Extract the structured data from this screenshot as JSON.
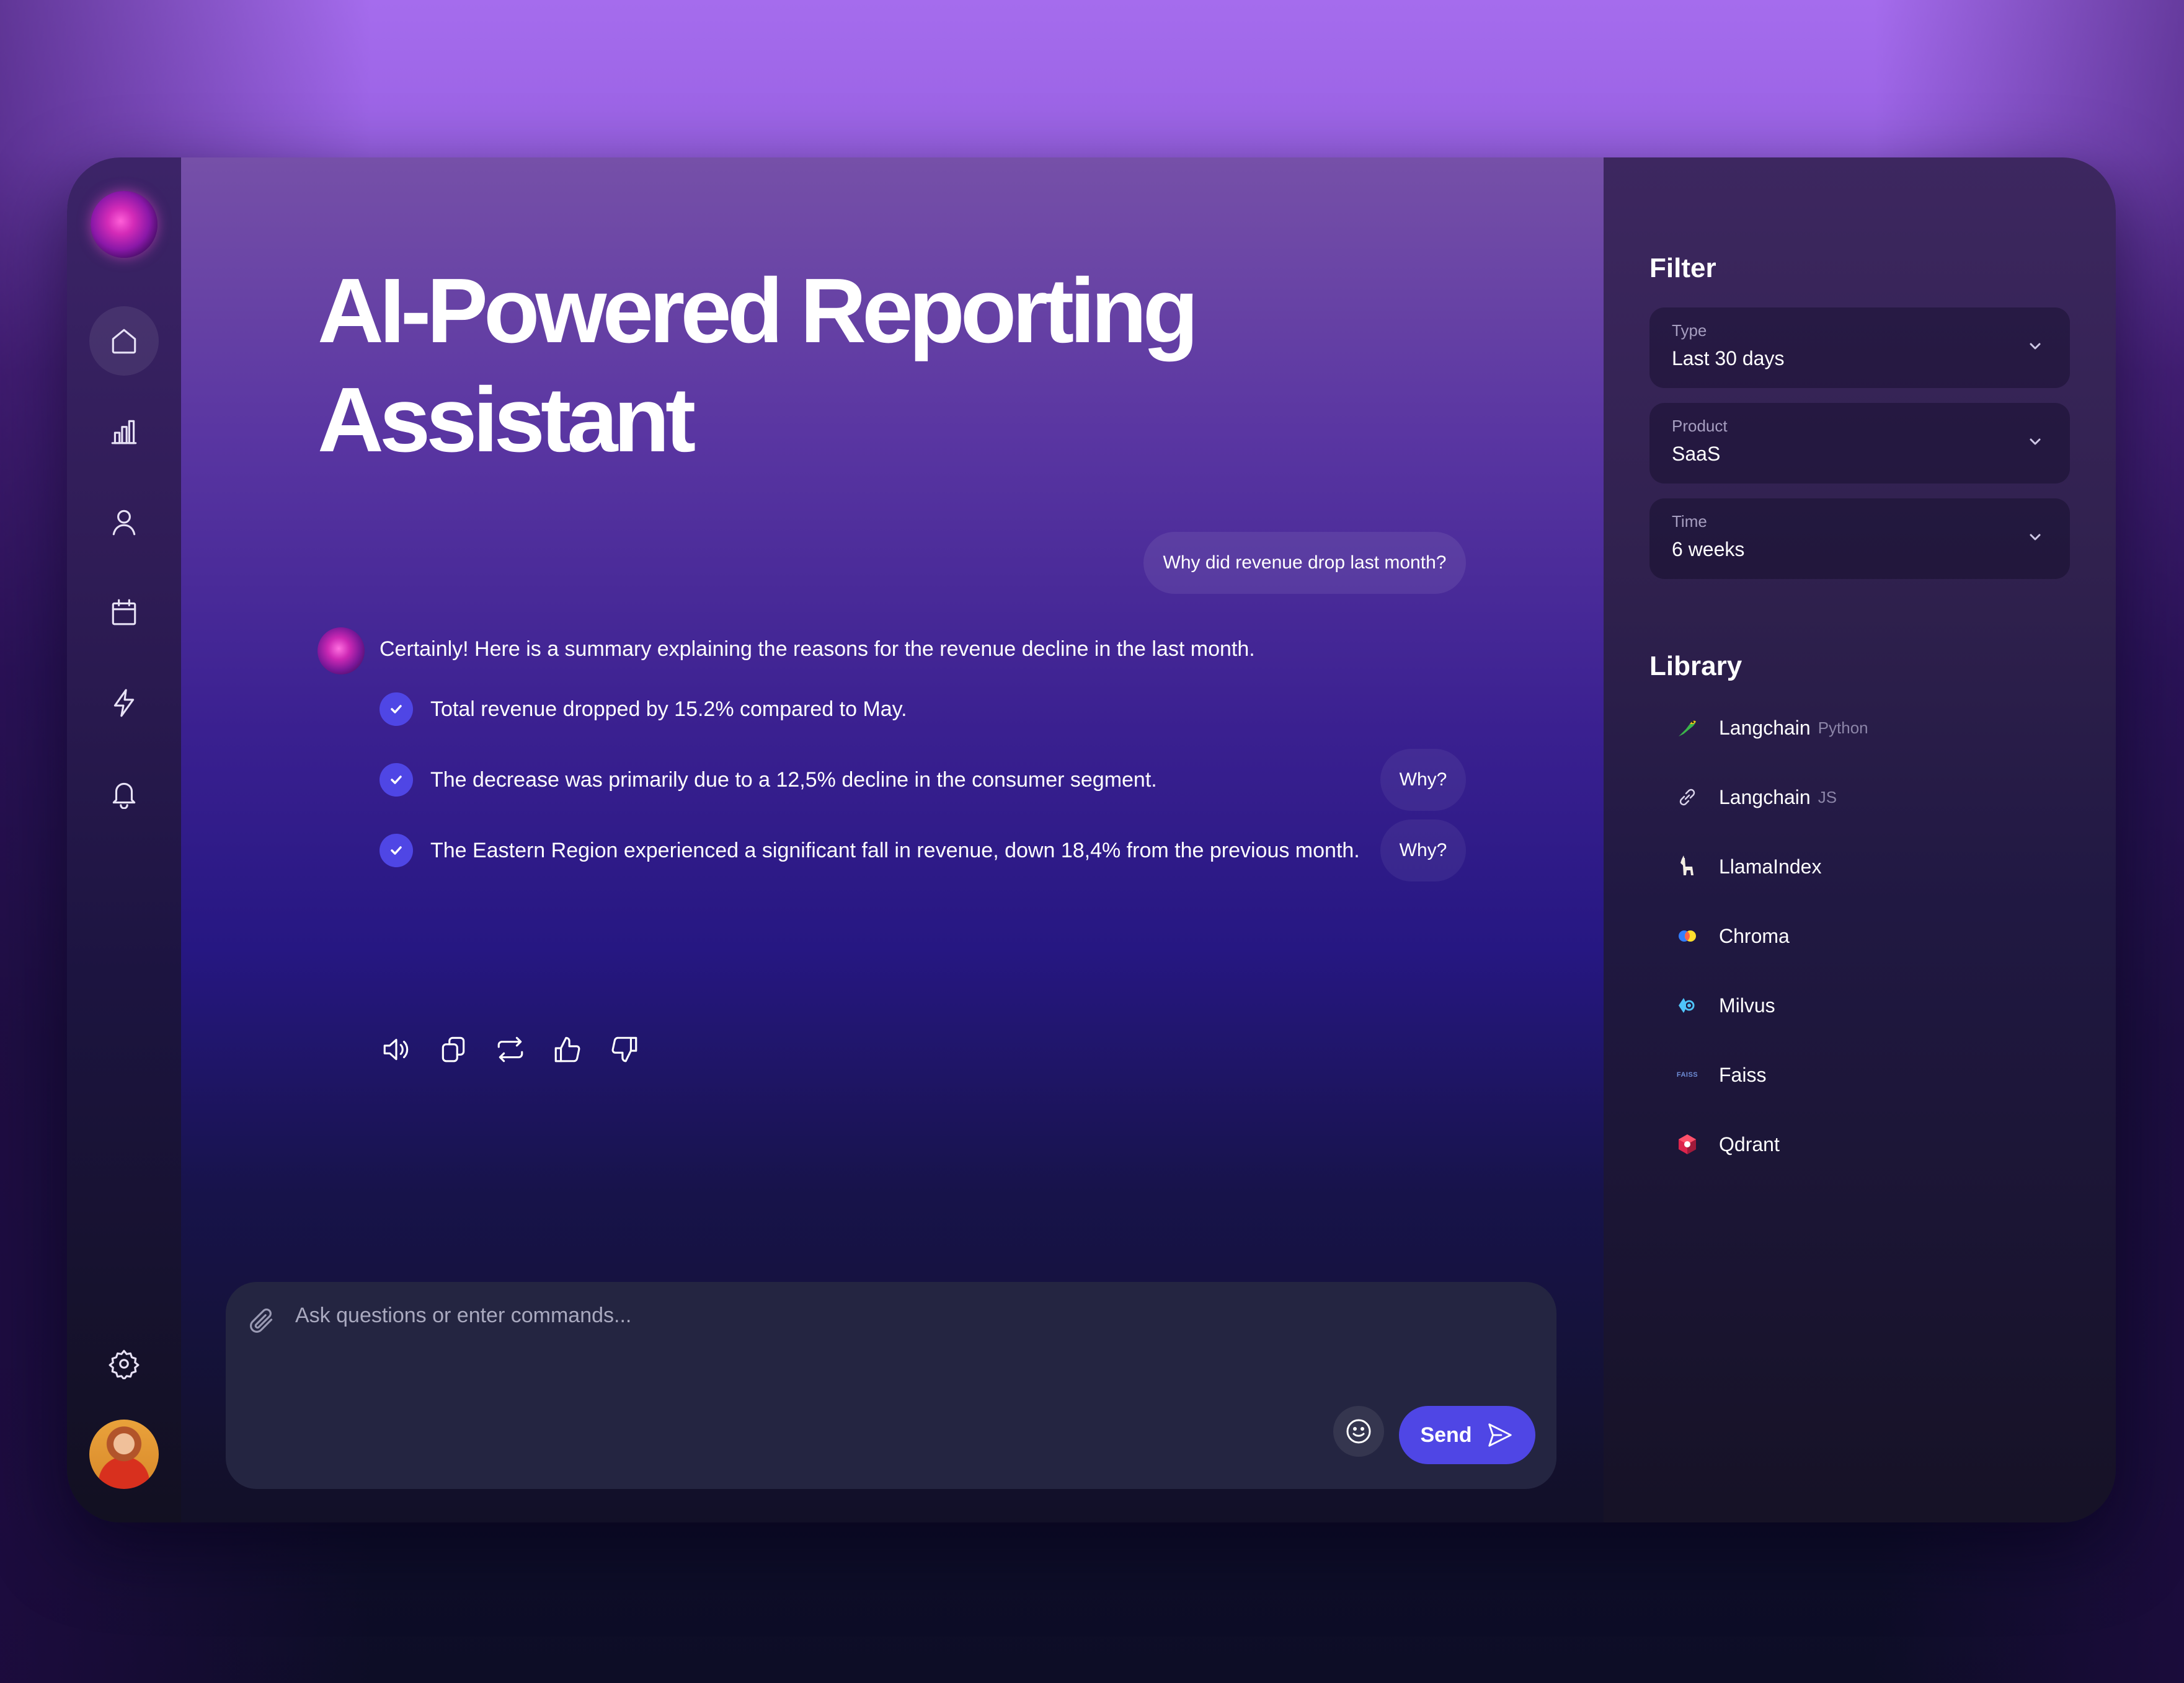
{
  "main": {
    "title_line1": "AI-Powered Reporting",
    "title_line2": "Assistant"
  },
  "chat": {
    "user_message": "Why did revenue drop last month?",
    "bot_intro": "Certainly! Here is a summary explaining the reasons for the revenue decline in the last month.",
    "bullets": [
      "Total revenue dropped by 15.2% compared to May.",
      "The decrease was primarily due to a 12,5% decline in the consumer segment.",
      "The Eastern Region experienced a significant fall in revenue, down 18,4% from the previous month."
    ],
    "why_label": "Why?"
  },
  "composer": {
    "placeholder": "Ask questions or enter commands...",
    "send_label": "Send"
  },
  "filter": {
    "title": "Filter",
    "dropdowns": [
      {
        "label": "Type",
        "value": "Last 30 days"
      },
      {
        "label": "Product",
        "value": "SaaS"
      },
      {
        "label": "Time",
        "value": "6 weeks"
      }
    ]
  },
  "library": {
    "title": "Library",
    "items": [
      {
        "name": "Langchain",
        "tag": "Python",
        "icon": "parrot-icon"
      },
      {
        "name": "Langchain",
        "tag": "JS",
        "icon": "link-icon"
      },
      {
        "name": "LlamaIndex",
        "tag": "",
        "icon": "llama-icon"
      },
      {
        "name": "Chroma",
        "tag": "",
        "icon": "chroma-icon"
      },
      {
        "name": "Milvus",
        "tag": "",
        "icon": "milvus-icon"
      },
      {
        "name": "Faiss",
        "tag": "",
        "icon": "faiss-icon"
      },
      {
        "name": "Qdrant",
        "tag": "",
        "icon": "qdrant-icon"
      }
    ],
    "faiss_logo_text": "FAISS"
  },
  "colors": {
    "accent": "#4f46e5",
    "brand_orb": "#d42bb8",
    "panel_bg": "#242541"
  }
}
